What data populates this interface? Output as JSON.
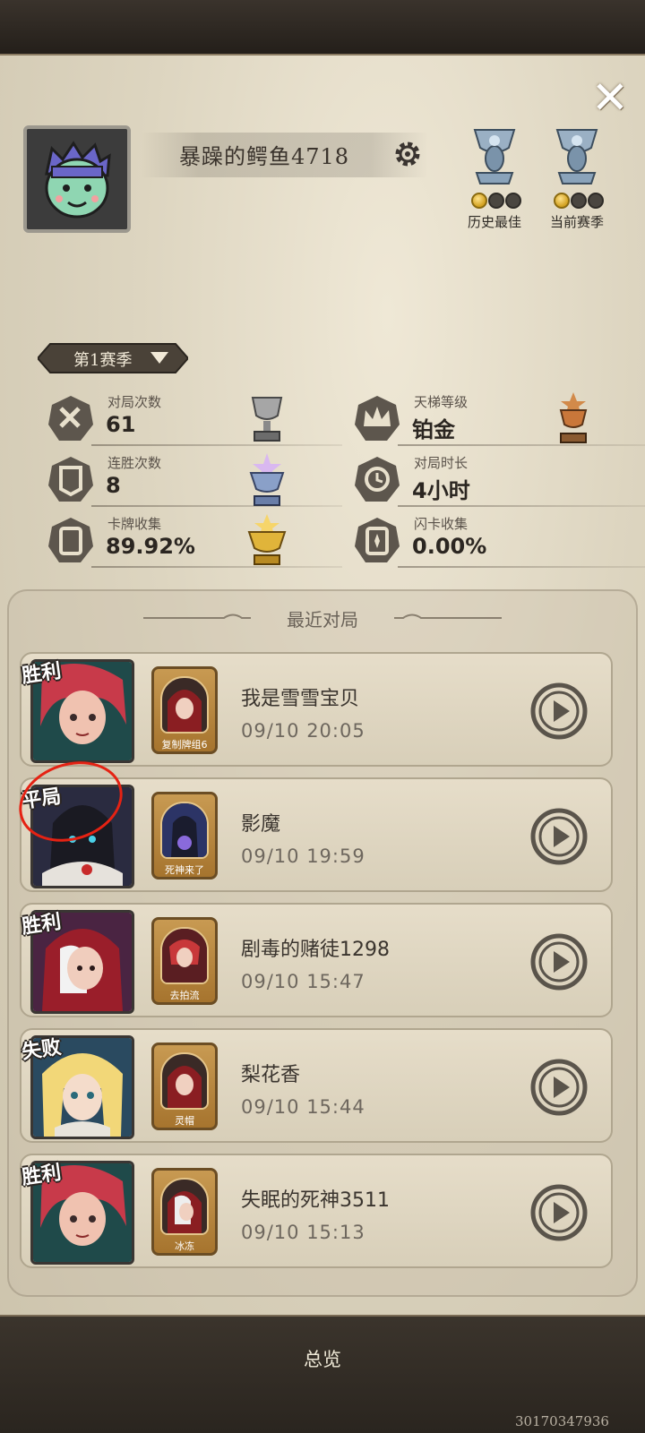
{
  "profile": {
    "player_name": "暴躁的鳄鱼4718",
    "avatar_icon": "player-avatar",
    "badges": [
      {
        "label": "历史最佳",
        "filled_dots": 1,
        "total_dots": 3
      },
      {
        "label": "当前赛季",
        "filled_dots": 1,
        "total_dots": 3
      }
    ]
  },
  "season": {
    "selected": "第1赛季"
  },
  "stats": [
    {
      "title": "对局次数",
      "value": "61",
      "icon": "swords-icon"
    },
    {
      "title": "天梯等级",
      "value": "铂金",
      "icon": "crown-icon"
    },
    {
      "title": "连胜次数",
      "value": "8",
      "icon": "streak-icon"
    },
    {
      "title": "对局时长",
      "value": "4小时",
      "icon": "clock-icon"
    },
    {
      "title": "卡牌收集",
      "value": "89.92%",
      "icon": "card-icon"
    },
    {
      "title": "闪卡收集",
      "value": "0.00%",
      "icon": "flash-card-icon"
    }
  ],
  "recent": {
    "title": "最近对局",
    "matches": [
      {
        "result": "胜利",
        "deck": "复制牌组6",
        "opponent": "我是雪雪宝贝",
        "time": "09/10 20:05"
      },
      {
        "result": "平局",
        "deck": "死神来了",
        "opponent": "影魔",
        "time": "09/10 19:59"
      },
      {
        "result": "胜利",
        "deck": "去拍流",
        "opponent": "剧毒的赌徒1298",
        "time": "09/10 15:47"
      },
      {
        "result": "失败",
        "deck": "灵帽",
        "opponent": "梨花香",
        "time": "09/10 15:44"
      },
      {
        "result": "胜利",
        "deck": "冰冻",
        "opponent": "失眠的死神3511",
        "time": "09/10 15:13"
      }
    ]
  },
  "footer": {
    "tab": "总览"
  },
  "watermark": "30170347936",
  "colors": {
    "accent_gold": "#d1a01f",
    "annotation_red": "#e52213",
    "panel_bg": "#e6dfcd"
  }
}
